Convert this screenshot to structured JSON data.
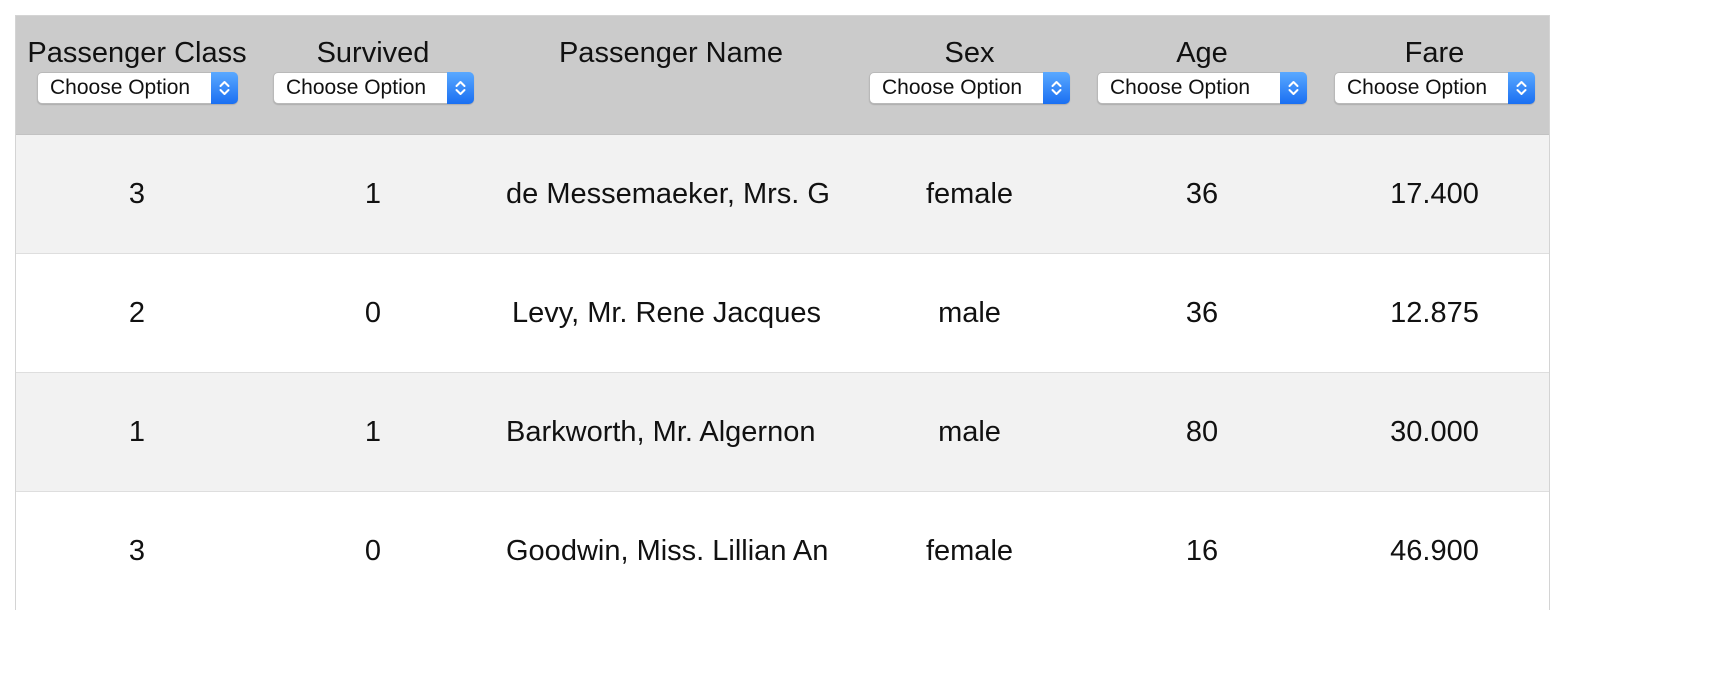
{
  "table": {
    "columns": [
      {
        "label": "Passenger Class",
        "filter": "Choose Option"
      },
      {
        "label": "Survived",
        "filter": "Choose Option"
      },
      {
        "label": "Passenger Name",
        "filter": null
      },
      {
        "label": "Sex",
        "filter": "Choose Option"
      },
      {
        "label": "Age",
        "filter": "Choose Option"
      },
      {
        "label": "Fare",
        "filter": "Choose Option"
      }
    ],
    "rows": [
      {
        "pclass": "3",
        "survived": "1",
        "name": "de Messemaeker, Mrs. G",
        "sex": "female",
        "age": "36",
        "fare": "17.400"
      },
      {
        "pclass": "2",
        "survived": "0",
        "name": "Levy, Mr. Rene Jacques",
        "sex": "male",
        "age": "36",
        "fare": "12.875"
      },
      {
        "pclass": "1",
        "survived": "1",
        "name": "Barkworth, Mr. Algernon",
        "sex": "male",
        "age": "80",
        "fare": "30.000"
      },
      {
        "pclass": "3",
        "survived": "0",
        "name": "Goodwin, Miss. Lillian An",
        "sex": "female",
        "age": "16",
        "fare": "46.900"
      }
    ]
  },
  "icons": {
    "select_arrows": "up-down-chevron-icon"
  },
  "colors": {
    "header_bg": "#cbcbcb",
    "row_odd_bg": "#f2f2f2",
    "row_even_bg": "#ffffff",
    "select_button": "#2b7ef6"
  }
}
